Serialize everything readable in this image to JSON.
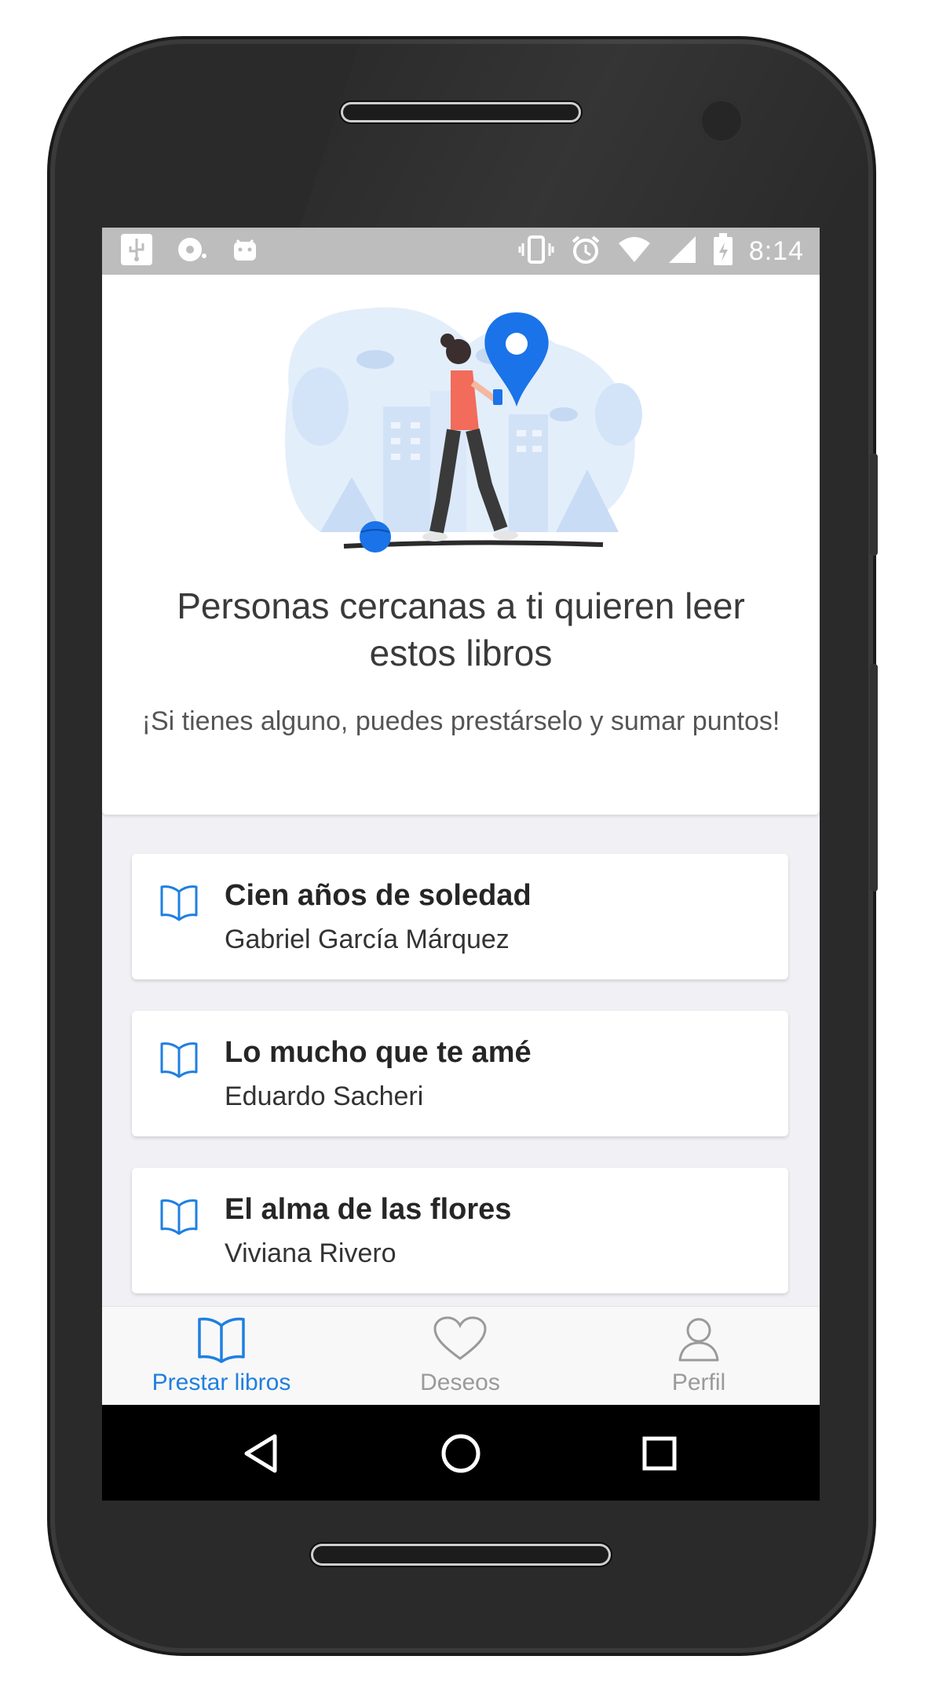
{
  "status_bar": {
    "time": "8:14",
    "left_icons": [
      "usb-icon",
      "sync-icon",
      "android-icon"
    ],
    "right_icons": [
      "vibrate-icon",
      "alarm-icon",
      "wifi-icon",
      "signal-icon",
      "battery-charging-icon"
    ]
  },
  "hero": {
    "title": "Personas cercanas a ti quieren leer estos libros",
    "subtitle": "¡Si tienes alguno, puedes prestárselo y sumar puntos!"
  },
  "books": [
    {
      "title": "Cien años de soledad",
      "author": "Gabriel García Márquez"
    },
    {
      "title": "Lo mucho que te amé",
      "author": "Eduardo Sacheri"
    },
    {
      "title": "El alma de las flores",
      "author": "Viviana Rivero"
    }
  ],
  "tabs": [
    {
      "label": "Prestar libros",
      "icon": "book-icon",
      "active": true
    },
    {
      "label": "Deseos",
      "icon": "heart-icon",
      "active": false
    },
    {
      "label": "Perfil",
      "icon": "person-icon",
      "active": false
    }
  ],
  "colors": {
    "accent": "#1f7fe0",
    "inactive": "#9a9a9a",
    "accent_illustration": "#1a73e8",
    "figure_shirt": "#f26b5b"
  }
}
